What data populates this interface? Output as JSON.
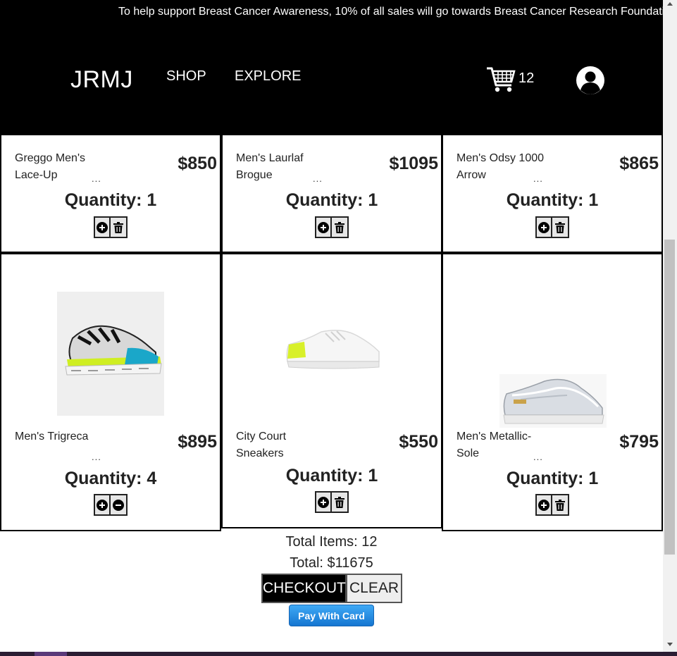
{
  "header": {
    "banner": "To help support Breast Cancer Awareness, 10% of all sales will go towards Breast Cancer Research Foundati",
    "logo": "JRMJ",
    "nav": {
      "shop": "SHOP",
      "explore": "EXPLORE"
    },
    "cart_icon": "shopping-cart-icon",
    "cart_count": "12",
    "avatar_icon": "user-avatar-icon"
  },
  "products": [
    {
      "name": "Greggo Men's Lace-Up",
      "ellipsis": "...",
      "price": "$850",
      "quantity": "Quantity: 1",
      "actions": [
        "plus-icon",
        "trash-icon"
      ]
    },
    {
      "name": "Men's Laurlaf Brogue",
      "ellipsis": "...",
      "price": "$1095",
      "quantity": "Quantity: 1",
      "actions": [
        "plus-icon",
        "trash-icon"
      ]
    },
    {
      "name": "Men's Odsy 1000 Arrow",
      "ellipsis": "...",
      "price": "$865",
      "quantity": "Quantity: 1",
      "actions": [
        "plus-icon",
        "trash-icon"
      ]
    },
    {
      "name": "Men's Trigreca",
      "ellipsis": "...",
      "price": "$895",
      "quantity": "Quantity: 4",
      "actions": [
        "plus-icon",
        "minus-icon"
      ]
    },
    {
      "name": "City Court Sneakers",
      "ellipsis": "",
      "price": "$550",
      "quantity": "Quantity: 1",
      "actions": [
        "plus-icon",
        "trash-icon"
      ]
    },
    {
      "name": "Men's Metallic-Sole",
      "ellipsis": "...",
      "price": "$795",
      "quantity": "Quantity: 1",
      "actions": [
        "plus-icon",
        "trash-icon"
      ]
    }
  ],
  "summary": {
    "total_items": "Total Items: 12",
    "total": "Total: $11675",
    "checkout_label": "CHECKOUT",
    "clear_label": "CLEAR",
    "pay_label": "Pay With Card"
  },
  "colors": {
    "header_bg": "#000000",
    "pay_button": "#1f86e0",
    "card_border": "#000000"
  }
}
